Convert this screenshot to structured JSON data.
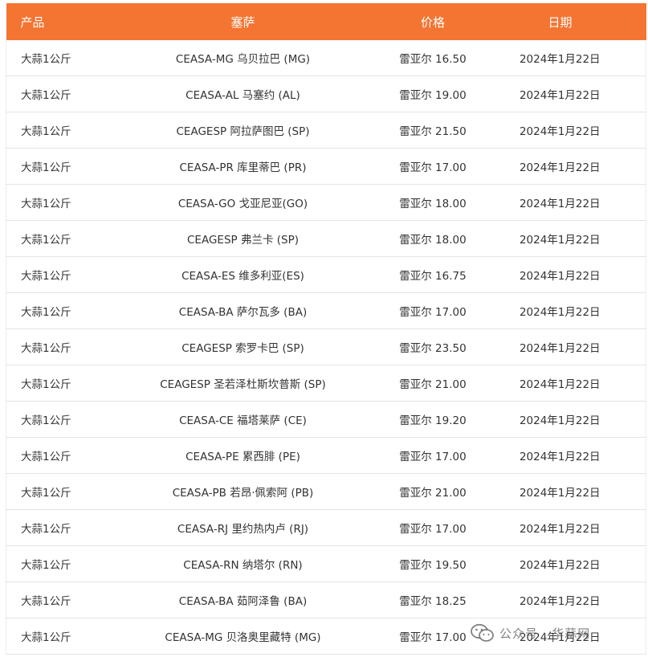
{
  "table": {
    "headers": [
      "产品",
      "塞萨",
      "价格",
      "日期"
    ],
    "rows": [
      [
        "大蒜1公斤",
        "CEASA-MG 乌贝拉巴 (MG)",
        "雷亚尔 16.50",
        "2024年1月22日"
      ],
      [
        "大蒜1公斤",
        "CEASA-AL 马塞约 (AL)",
        "雷亚尔 19.00",
        "2024年1月22日"
      ],
      [
        "大蒜1公斤",
        "CEAGESP 阿拉萨图巴 (SP)",
        "雷亚尔 21.50",
        "2024年1月22日"
      ],
      [
        "大蒜1公斤",
        "CEASA-PR 库里蒂巴 (PR)",
        "雷亚尔 17.00",
        "2024年1月22日"
      ],
      [
        "大蒜1公斤",
        "CEASA-GO 戈亚尼亚(GO)",
        "雷亚尔 18.00",
        "2024年1月22日"
      ],
      [
        "大蒜1公斤",
        "CEAGESP 弗兰卡 (SP)",
        "雷亚尔 18.00",
        "2024年1月22日"
      ],
      [
        "大蒜1公斤",
        "CEASA-ES 维多利亚(ES)",
        "雷亚尔 16.75",
        "2024年1月22日"
      ],
      [
        "大蒜1公斤",
        "CEASA-BA 萨尔瓦多 (BA)",
        "雷亚尔 17.00",
        "2024年1月22日"
      ],
      [
        "大蒜1公斤",
        "CEAGESP 索罗卡巴 (SP)",
        "雷亚尔 23.50",
        "2024年1月22日"
      ],
      [
        "大蒜1公斤",
        "CEAGESP 圣若泽杜斯坎普斯 (SP)",
        "雷亚尔 21.00",
        "2024年1月22日"
      ],
      [
        "大蒜1公斤",
        "CEASA-CE 福塔莱萨 (CE)",
        "雷亚尔 19.20",
        "2024年1月22日"
      ],
      [
        "大蒜1公斤",
        "CEASA-PE 累西腓 (PE)",
        "雷亚尔 17.00",
        "2024年1月22日"
      ],
      [
        "大蒜1公斤",
        "CEASA-PB 若昂·佩索阿 (PB)",
        "雷亚尔 21.00",
        "2024年1月22日"
      ],
      [
        "大蒜1公斤",
        "CEASA-RJ 里约热内卢 (RJ)",
        "雷亚尔 17.00",
        "2024年1月22日"
      ],
      [
        "大蒜1公斤",
        "CEASA-RN 纳塔尔 (RN)",
        "雷亚尔 19.50",
        "2024年1月22日"
      ],
      [
        "大蒜1公斤",
        "CEASA-BA 茹阿泽鲁 (BA)",
        "雷亚尔 18.25",
        "2024年1月22日"
      ],
      [
        "大蒜1公斤",
        "CEASA-MG 贝洛奥里藏特 (MG)",
        "雷亚尔 17.00",
        "2024年1月22日"
      ]
    ]
  },
  "watermark": {
    "label": "公众号 · 华蒜网",
    "icon": "wechat-icon"
  },
  "colors": {
    "header_bg": "#f47432",
    "header_text": "#ffffff",
    "row_text": "#333333",
    "row_border": "#e4e4e4"
  }
}
